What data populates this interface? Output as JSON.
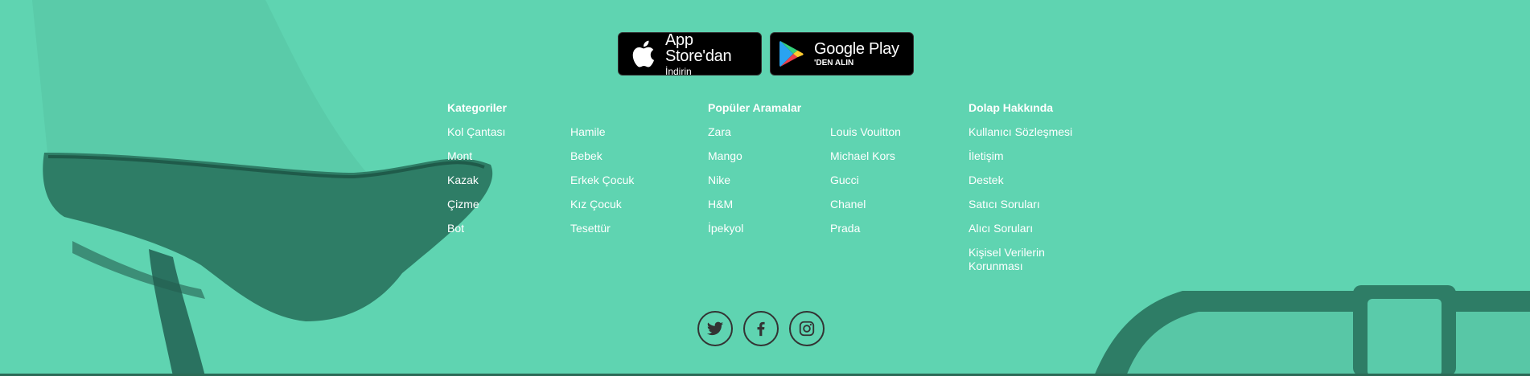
{
  "stores": {
    "appstore": {
      "main": "App Store'dan",
      "sub": "İndirin"
    },
    "googleplay": {
      "main": "Google Play",
      "sub": "'DEN ALIN"
    }
  },
  "categories": {
    "title": "Kategoriler",
    "col1": [
      "Kol Çantası",
      "Mont",
      "Kazak",
      "Çizme",
      "Bot"
    ],
    "col2": [
      "Hamile",
      "Bebek",
      "Erkek Çocuk",
      "Kız Çocuk",
      "Tesettür"
    ]
  },
  "popular": {
    "title": "Popüler Aramalar",
    "col1": [
      "Zara",
      "Mango",
      "Nike",
      "H&M",
      "İpekyol"
    ],
    "col2": [
      "Louis Vouitton",
      "Michael Kors",
      "Gucci",
      "Chanel",
      "Prada"
    ]
  },
  "about": {
    "title": "Dolap Hakkında",
    "links": [
      "Kullanıcı Sözleşmesi",
      "İletişim",
      "Destek",
      "Satıcı Soruları",
      "Alıcı Soruları",
      "Kişisel Verilerin Korunması"
    ]
  },
  "social": [
    "twitter-icon",
    "facebook-icon",
    "instagram-icon"
  ],
  "colors": {
    "background": "#5fd4b1",
    "icon_stroke": "#333333"
  }
}
